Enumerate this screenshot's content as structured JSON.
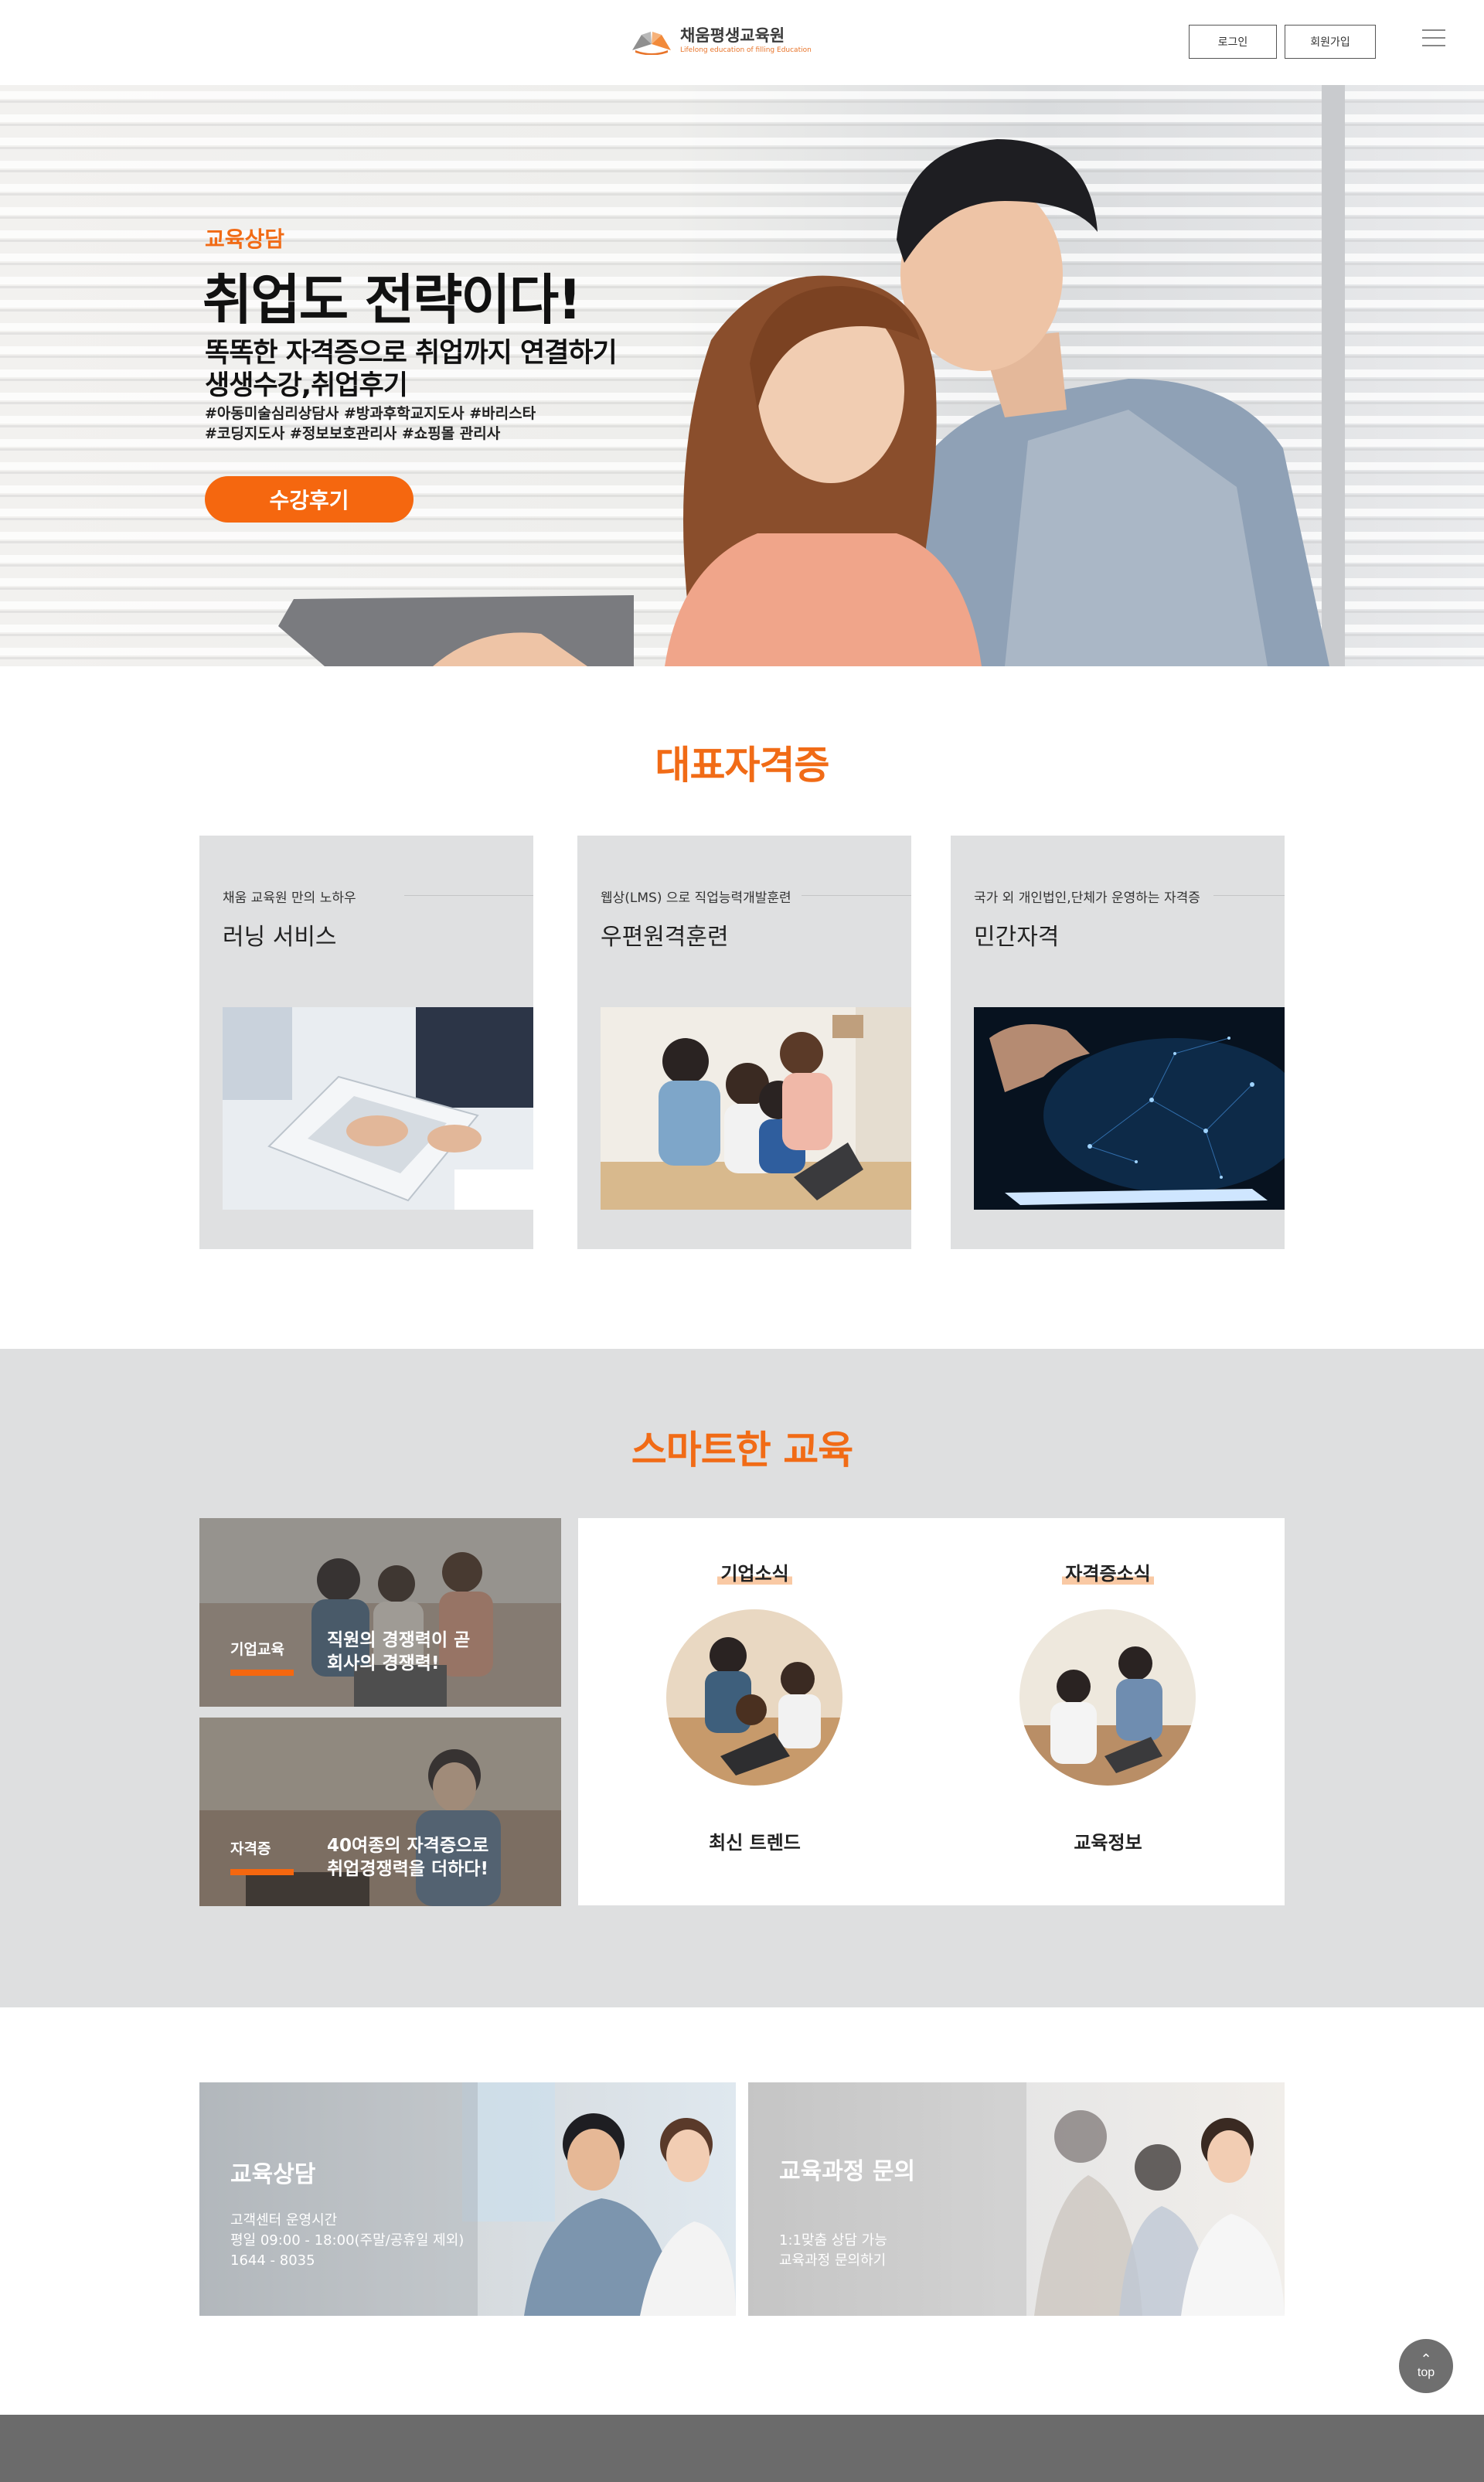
{
  "header": {
    "logo_title": "채움평생교육원",
    "logo_sub": "Lifelong education of filling Education",
    "login_label": "로그인",
    "signup_label": "회원가입",
    "menu_icon": "hamburger-menu-icon"
  },
  "hero": {
    "tag": "교육상담",
    "headline": "취업도 전략이다!",
    "sub1": "똑똑한 자격증으로 취업까지 연결하기",
    "sub2": "생생수강,취업후기",
    "tags1": "#아동미술심리상담사 #방과후학교지도사 #바리스타",
    "tags2": "#코딩지도사 #정보보호관리사 #쇼핑몰 관리사",
    "cta_label": "수강후기"
  },
  "certs": {
    "title": "대표자격증",
    "cards": [
      {
        "small": "채움 교육원 만의 노하우",
        "big": "러닝 서비스"
      },
      {
        "small": "웹상(LMS) 으로  직업능력개발훈련",
        "big": "우편원격훈련"
      },
      {
        "small": "국가 외 개인법인,단체가 운영하는 자격증",
        "big": "민간자격"
      }
    ]
  },
  "smart": {
    "title": "스마트한 교육",
    "tiles": [
      {
        "label": "기업교육",
        "desc1": "직원의 경쟁력이 곧",
        "desc2": "회사의 경쟁력!"
      },
      {
        "label": "자격증",
        "desc1": "40여종의 자격증으로",
        "desc2": "취업경쟁력을 더하다!"
      }
    ],
    "news": [
      {
        "title": "기업소식",
        "caption": "최신 트렌드"
      },
      {
        "title": "자격증소식",
        "caption": "교육정보"
      }
    ]
  },
  "consult": {
    "left": {
      "title": "교육상담",
      "line1": "고객센터 운영시간",
      "line2": "평일 09:00 - 18:00(주말/공휴일 제외)",
      "line3": "1644 - 8035"
    },
    "right": {
      "title": "교육과정 문의",
      "line1": "1:1맞춤 상담 가능",
      "line2": "교육과정 문의하기"
    }
  },
  "top_button": {
    "label": "top",
    "arrow": "⌃"
  },
  "colors": {
    "accent": "#f5670f",
    "section_gray": "#dedfe0",
    "footer": "#6b6b6b"
  }
}
